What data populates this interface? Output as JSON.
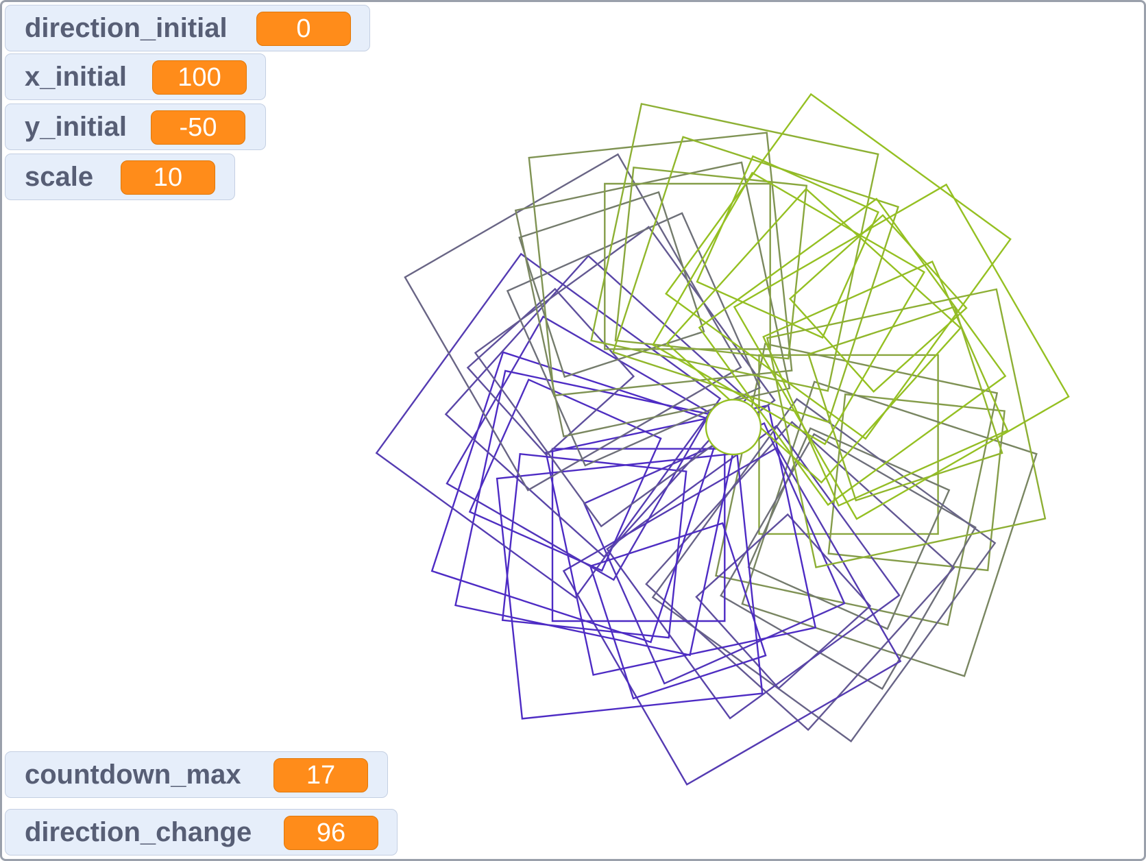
{
  "monitors": {
    "direction_initial": {
      "label": "direction_initial",
      "value": "0"
    },
    "x_initial": {
      "label": "x_initial",
      "value": "100"
    },
    "y_initial": {
      "label": "y_initial",
      "value": "-50"
    },
    "scale": {
      "label": "scale",
      "value": "10"
    },
    "countdown_max": {
      "label": "countdown_max",
      "value": "17"
    },
    "direction_change": {
      "label": "direction_change",
      "value": "96"
    }
  },
  "colors": {
    "purple": "#4d2bc4",
    "green": "#95c022",
    "monitor_value": "#ff8c1a"
  },
  "icons": [
    "pen-spirograph-drawing"
  ]
}
